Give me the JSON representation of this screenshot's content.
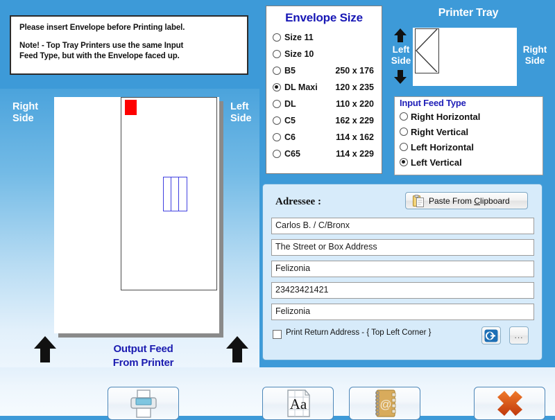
{
  "note": {
    "line1": "Please insert Envelope before Printing label.",
    "line2": "Note!  -  Top Tray Printers use the same Input",
    "line3": "Feed Type, but  with the Envelope faced up."
  },
  "envelope_size": {
    "title": "Envelope Size",
    "options": [
      {
        "label": "Size 11",
        "dimensions": "",
        "selected": false
      },
      {
        "label": "Size 10",
        "dimensions": "",
        "selected": false
      },
      {
        "label": "B5",
        "dimensions": "250 x 176",
        "selected": false
      },
      {
        "label": "DL Maxi",
        "dimensions": "120 x 235",
        "selected": true
      },
      {
        "label": "DL",
        "dimensions": "110 x 220",
        "selected": false
      },
      {
        "label": "C5",
        "dimensions": "162 x 229",
        "selected": false
      },
      {
        "label": "C6",
        "dimensions": "114 x 162",
        "selected": false
      },
      {
        "label": "C65",
        "dimensions": "114 x 229",
        "selected": false
      }
    ]
  },
  "printer_tray": {
    "title": "Printer Tray",
    "left_side": "Left\nSide",
    "left_side_l1": "Left",
    "left_side_l2": "Side",
    "right_side_l1": "Right",
    "right_side_l2": "Side",
    "up_arrow": "up-arrow-icon",
    "down_arrow": "down-arrow-icon"
  },
  "input_feed": {
    "legend": "Input Feed Type",
    "options": [
      {
        "label": "Right Horizontal",
        "selected": false
      },
      {
        "label": "Right Vertical",
        "selected": false
      },
      {
        "label": "Left Horizontal",
        "selected": false
      },
      {
        "label": "Left Vertical",
        "selected": true
      }
    ]
  },
  "addressee": {
    "title": "Adressee :",
    "paste_button": "Paste From ",
    "paste_button_accel": "C",
    "paste_button_rest": "lipboard",
    "fields": [
      {
        "value": "Carlos B. / C/Bronx",
        "placeholder": ""
      },
      {
        "value": "The Street or Box Address",
        "placeholder": ""
      },
      {
        "value": "Felizonia",
        "placeholder": ""
      },
      {
        "value": "23423421421",
        "placeholder": ""
      },
      {
        "value": "Felizonia",
        "placeholder": ""
      }
    ],
    "return_address_checkbox": "Print Return Address - { Top Left Corner }",
    "return_address_checked": false,
    "dots_button": "..."
  },
  "preview": {
    "right_side_l1": "Right",
    "right_side_l2": "Side",
    "left_side_l1": "Left",
    "left_side_l2": "Side",
    "output_l1": "Output Feed",
    "output_l2": "From Printer"
  },
  "toolbar": [
    {
      "name": "print-button",
      "icon": "printer-icon"
    },
    {
      "name": "font-button",
      "icon": "font-Aa-icon"
    },
    {
      "name": "address-book-button",
      "icon": "address-book-icon"
    },
    {
      "name": "close-button",
      "icon": "red-x-icon"
    }
  ],
  "colors": {
    "backdrop_blue": "#3d9ad8",
    "heading_blue": "#1717b5",
    "panel_blue": "#d7ebfa",
    "red_marker": "#fe0000",
    "address_block_blue": "#4040e0",
    "close_red": "#d9531e"
  }
}
